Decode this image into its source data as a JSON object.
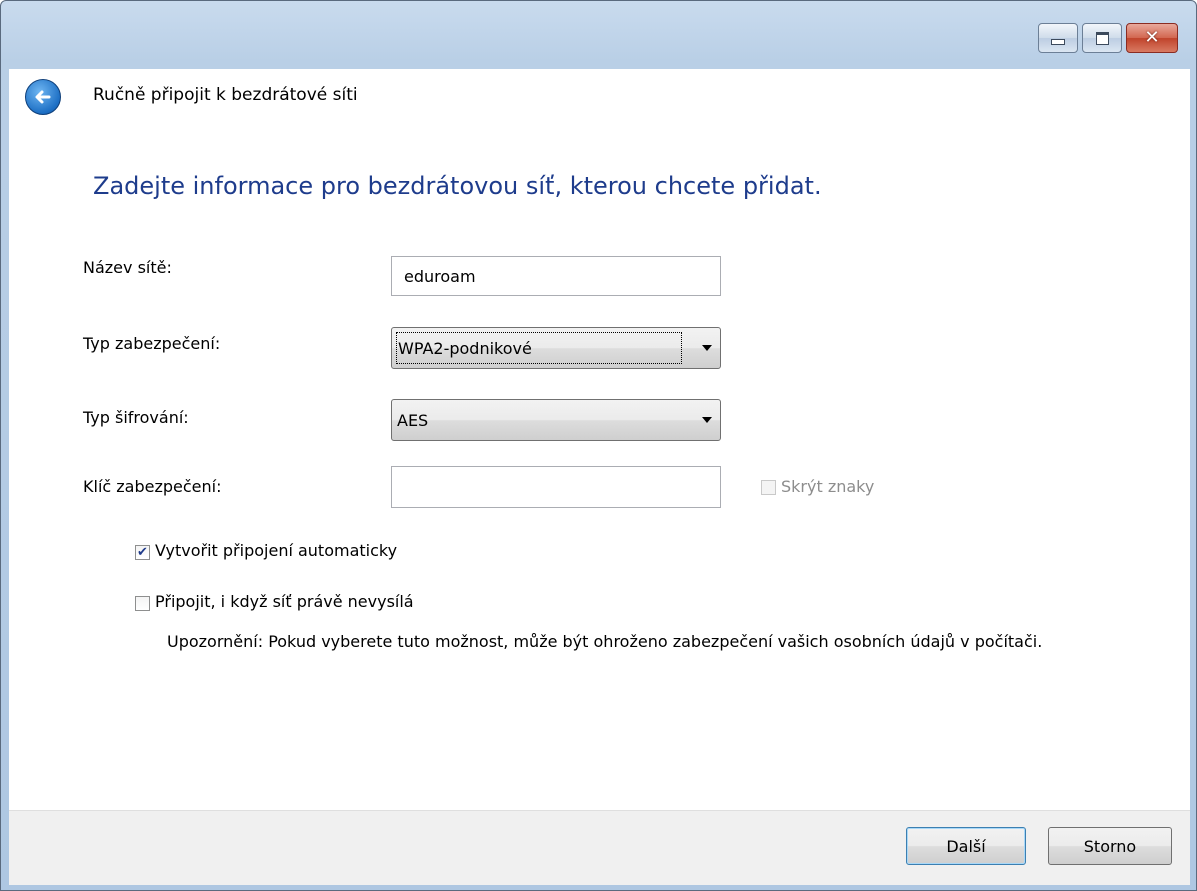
{
  "window": {
    "title": "Ručně připojit k bezdrátové síti",
    "controls": {
      "minimize": "minimize-icon",
      "maximize": "maximize-icon",
      "close": "close-icon"
    }
  },
  "headline": "Zadejte informace pro bezdrátovou síť, kterou chcete přidat.",
  "form": {
    "network_name": {
      "label": "Název sítě:",
      "value": "eduroam"
    },
    "security_type": {
      "label": "Typ zabezpečení:",
      "value": "WPA2-podnikové"
    },
    "encryption_type": {
      "label": "Typ šifrování:",
      "value": "AES"
    },
    "security_key": {
      "label": "Klíč zabezpečení:",
      "value": ""
    },
    "hide_characters": {
      "label": "Skrýt znaky",
      "checked": false,
      "enabled": false
    },
    "start_automatically": {
      "label": "Vytvořit připojení automaticky",
      "checked": true
    },
    "connect_not_broadcasting": {
      "label": "Připojit, i když síť právě nevysílá",
      "checked": false
    },
    "warning": "Upozornění: Pokud vyberete tuto možnost, může být ohroženo zabezpečení vašich osobních údajů v počítači."
  },
  "buttons": {
    "next": "Další",
    "cancel": "Storno"
  },
  "colors": {
    "headline": "#1e3c8c",
    "frame": "#b9cfe6",
    "footer": "#f0f0f0"
  }
}
